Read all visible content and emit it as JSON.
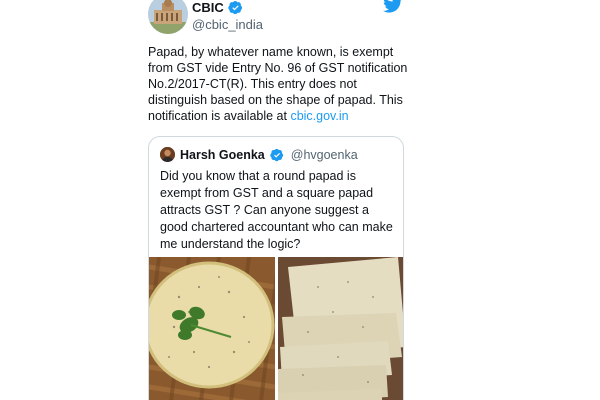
{
  "tweet": {
    "display_name": "CBIC",
    "handle": "@cbic_india",
    "body_text": "Papad, by whatever name known, is exempt from GST vide Entry No. 96 of GST notification No.2/2017-CT(R). This entry does not distinguish based on the shape of papad. This notification is available at ",
    "link_text": "cbic.gov.in"
  },
  "quoted_tweet": {
    "display_name": "Harsh Goenka",
    "handle": "@hvgoenka",
    "body_text": "Did you know that a round papad is exempt from GST and a square papad attracts GST ? Can anyone suggest a good chartered accountant who can make me understand the logic?"
  },
  "media": [
    {
      "icon": "round-papad-image"
    },
    {
      "icon": "square-papad-image"
    }
  ],
  "colors": {
    "link": "#1d9bf0",
    "verified": "#1d9bf0",
    "secondary_text": "#536471",
    "border": "#cfd9de"
  }
}
